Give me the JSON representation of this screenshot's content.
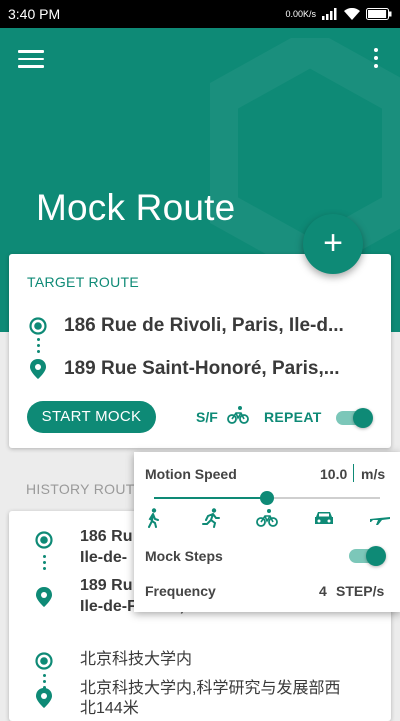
{
  "status_bar": {
    "time": "3:40 PM",
    "speed": "0.00K/s",
    "battery_level": 0.95
  },
  "header": {
    "title": "Mock Route",
    "menu_icon": "hamburger-menu-icon",
    "more_icon": "more-vert-icon",
    "fab_icon": "plus-icon",
    "color": "#0e8a76"
  },
  "target_route": {
    "heading": "TARGET ROUTE",
    "start_address": "186 Rue de Rivoli, Paris, Ile-d...",
    "end_address": "189 Rue Saint-Honoré, Paris,...",
    "start_button": "START MOCK",
    "sf_label": "S/F",
    "sf_icon": "bike-icon",
    "repeat_label": "REPEAT",
    "repeat_enabled": true
  },
  "history": {
    "title": "HISTORY ROUT",
    "items": [
      {
        "start_line1": "186 Ru",
        "start_line2": "Ile-de-",
        "end_line1": "189 Ru",
        "end_line2": "Ile-de-France, France"
      },
      {
        "start_line1": "北京科技大学内",
        "end_line1": "北京科技大学内,科学研究与发展部西",
        "end_line2": "北144米"
      }
    ]
  },
  "speed_panel": {
    "motion_speed_label": "Motion Speed",
    "speed_value": "10.0",
    "speed_unit": "m/s",
    "slider_fraction": 0.5,
    "modes": [
      "walk-icon",
      "run-icon",
      "bike-icon",
      "car-icon",
      "plane-icon"
    ],
    "mock_steps_label": "Mock Steps",
    "mock_steps_enabled": true,
    "frequency_label": "Frequency",
    "frequency_value": "4",
    "frequency_unit": "STEP/s"
  }
}
